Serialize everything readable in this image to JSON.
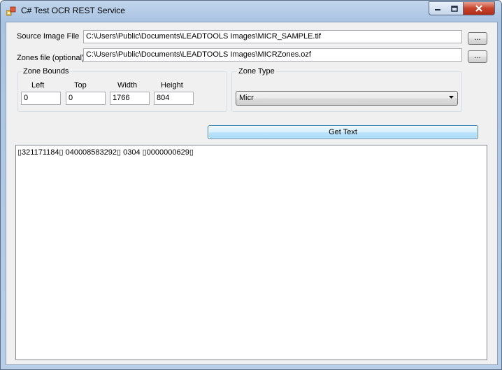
{
  "window": {
    "title": "C# Test OCR REST Service",
    "icon": "app-windows-icon",
    "controls": [
      "minimize-icon",
      "maximize-icon",
      "close-icon"
    ]
  },
  "source_image": {
    "label": "Source Image File",
    "value": "C:\\Users\\Public\\Documents\\LEADTOOLS Images\\MICR_SAMPLE.tif",
    "browse_label": "..."
  },
  "zones_file": {
    "label": "Zones file (optional)",
    "value": "C:\\Users\\Public\\Documents\\LEADTOOLS Images\\MICRZones.ozf",
    "browse_label": "..."
  },
  "zone_bounds": {
    "title": "Zone Bounds",
    "left_label": "Left",
    "left_value": "0",
    "top_label": "Top",
    "top_value": "0",
    "width_label": "Width",
    "width_value": "1766",
    "height_label": "Height",
    "height_value": "804"
  },
  "zone_type": {
    "title": "Zone Type",
    "selected": "Micr"
  },
  "get_text_label": "Get Text",
  "output_text": "▯321171184▯ 040008583292▯ 0304 ▯0000000629▯"
}
